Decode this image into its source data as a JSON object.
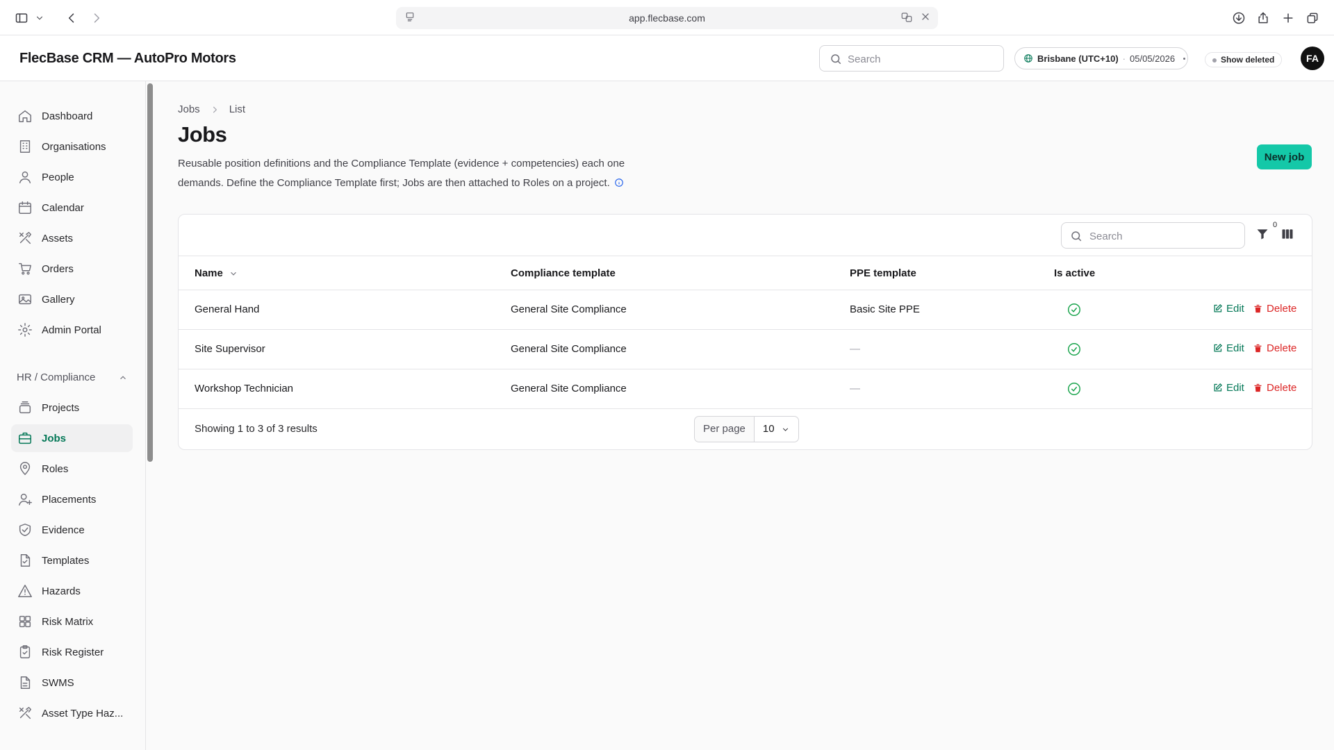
{
  "browser": {
    "url": "app.flecbase.com"
  },
  "header": {
    "title": "FlecBase CRM — AutoPro Motors",
    "search_placeholder": "Search",
    "timezone": "Brisbane (UTC+10)",
    "date": "05/05/2026",
    "show_deleted": "Show deleted",
    "avatar": "FA"
  },
  "sidebar": {
    "items": [
      {
        "label": "Dashboard",
        "icon": "home-icon"
      },
      {
        "label": "Organisations",
        "icon": "building-icon"
      },
      {
        "label": "People",
        "icon": "user-icon"
      },
      {
        "label": "Calendar",
        "icon": "calendar-icon"
      },
      {
        "label": "Assets",
        "icon": "tools-icon"
      },
      {
        "label": "Orders",
        "icon": "cart-icon"
      },
      {
        "label": "Gallery",
        "icon": "image-icon"
      },
      {
        "label": "Admin Portal",
        "icon": "gear-icon"
      }
    ],
    "section_label": "HR / Compliance",
    "section_items": [
      {
        "label": "Projects",
        "icon": "stack-icon"
      },
      {
        "label": "Jobs",
        "icon": "briefcase-icon",
        "active": true
      },
      {
        "label": "Roles",
        "icon": "map-pin-icon"
      },
      {
        "label": "Placements",
        "icon": "user-plus-icon"
      },
      {
        "label": "Evidence",
        "icon": "shield-check-icon"
      },
      {
        "label": "Templates",
        "icon": "file-check-icon"
      },
      {
        "label": "Hazards",
        "icon": "warning-icon"
      },
      {
        "label": "Risk Matrix",
        "icon": "grid-icon"
      },
      {
        "label": "Risk Register",
        "icon": "clipboard-icon"
      },
      {
        "label": "SWMS",
        "icon": "document-icon"
      },
      {
        "label": "Asset Type Haz...",
        "icon": "tools-icon"
      }
    ]
  },
  "main": {
    "breadcrumb": [
      "Jobs",
      "List"
    ],
    "title": "Jobs",
    "description": "Reusable position definitions and the Compliance Template (evidence + competencies) each one demands. Define the Compliance Template first; Jobs are then attached to Roles on a project.",
    "new_button": "New job",
    "table": {
      "search_placeholder": "Search",
      "filter_count": "0",
      "columns": [
        "Name",
        "Compliance template",
        "PPE template",
        "Is active"
      ],
      "rows": [
        {
          "name": "General Hand",
          "compliance": "General Site Compliance",
          "ppe": "Basic Site PPE",
          "active": true
        },
        {
          "name": "Site Supervisor",
          "compliance": "General Site Compliance",
          "ppe": "—",
          "active": true
        },
        {
          "name": "Workshop Technician",
          "compliance": "General Site Compliance",
          "ppe": "—",
          "active": true
        }
      ],
      "edit_label": "Edit",
      "delete_label": "Delete",
      "footer": "Showing 1 to 3 of 3 results",
      "per_page_label": "Per page",
      "per_page_value": "10"
    }
  },
  "colors": {
    "accent": "#047857",
    "button": "#14c8a8",
    "danger": "#dc2626",
    "success": "#16a34a"
  }
}
